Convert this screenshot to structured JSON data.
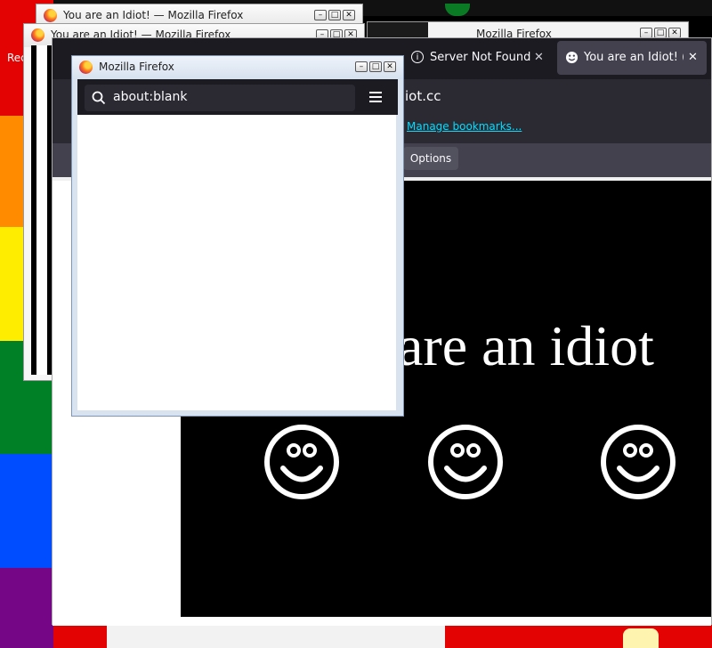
{
  "desktop": {
    "rainbow_colors": [
      "#e40303",
      "#ff8c00",
      "#ffed00",
      "#008026",
      "#004dff",
      "#750787"
    ]
  },
  "background_windows": {
    "win1_title": "You are an Idiot! — Mozilla Firefox",
    "win2_title": "You are an Idiot! — Mozilla Firefox",
    "win3_title": "Mozilla Firefox",
    "left_edge_text": "Rec"
  },
  "main_browser": {
    "tabs": [
      {
        "label": "Server Not Found",
        "icon": "info-icon",
        "close": "✕"
      },
      {
        "label": "You are an Idiot! (dot",
        "icon": "smiley-icon",
        "close": "✕"
      }
    ],
    "url_fragment": "iot.cc",
    "bookmarks_link": "Manage bookmarks...",
    "options_label": "Options",
    "page_text": "are an idiot"
  },
  "popup": {
    "title": "Mozilla Firefox",
    "address_value": "about:blank",
    "menu_icon": "hamburger-menu-icon"
  },
  "window_controls": {
    "minimize": "–",
    "maximize": "□",
    "close": "✕"
  }
}
